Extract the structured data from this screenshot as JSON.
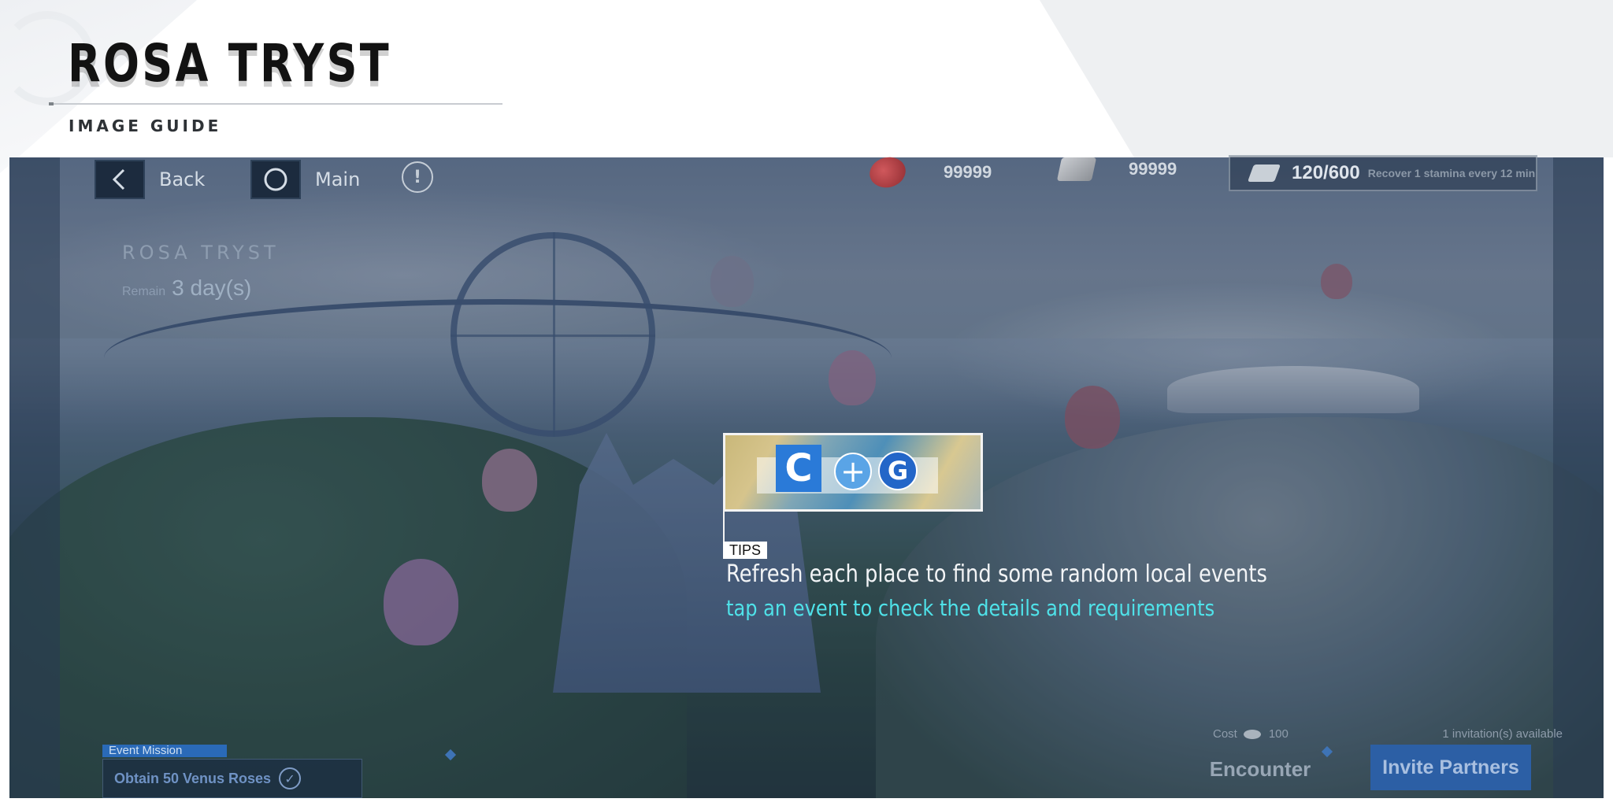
{
  "guide": {
    "title": "ROSA TRYST",
    "subtitle": "IMAGE GUIDE"
  },
  "hud": {
    "back_label": "Back",
    "main_label": "Main",
    "info_glyph": "!",
    "rose_count": "99999",
    "ticket_count": "99999",
    "stamina_value": "120/600",
    "stamina_hint": "Recover 1 stamina every 12 min"
  },
  "event": {
    "name": "ROSA TRYST",
    "remain_label": "Remain",
    "remain_value": "3 day(s)"
  },
  "tip": {
    "tag": "TIPS",
    "line1": "Refresh each place to find some random local events",
    "line2": "tap an event to check the details and requirements",
    "logo_c": "C",
    "logo_plus": "+",
    "logo_g": "G"
  },
  "mission": {
    "tag": "Event Mission",
    "text": "Obtain 50 Venus Roses",
    "check_glyph": "✓"
  },
  "actions": {
    "cost_label": "Cost",
    "cost_value": "100",
    "encounter_label": "Encounter",
    "invitations": "1 invitation(s) available",
    "invite_label": "Invite Partners"
  },
  "colors": {
    "tip_cyan": "#4fe2e9",
    "invite_blue": "#2c5fa5",
    "mission_blue": "#2a6ab8"
  },
  "icons": [
    "back-chevron-icon",
    "main-circle-icon",
    "info-icon",
    "rose-icon",
    "ticket-icon",
    "stamina-cube-icon",
    "coin-icon",
    "check-icon"
  ]
}
